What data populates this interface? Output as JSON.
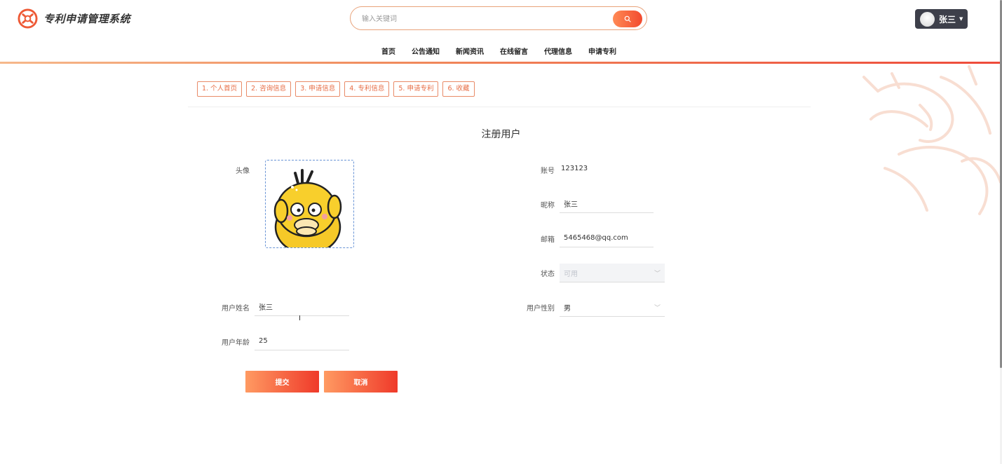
{
  "app": {
    "title": "专利申请管理系统",
    "brand_color": "#ef4a32"
  },
  "search": {
    "placeholder": "输入关键词",
    "value": "",
    "icon": "search-icon"
  },
  "user": {
    "name": "张三",
    "avatar_icon": "avatar",
    "caret_icon": "caret-down-icon"
  },
  "nav": {
    "items": [
      "首页",
      "公告通知",
      "新闻资讯",
      "在线留言",
      "代理信息",
      "申请专利"
    ]
  },
  "tabs": [
    "1. 个人首页",
    "2. 咨询信息",
    "3. 申请信息",
    "4. 专利信息",
    "5. 申请专利",
    "6. 收藏"
  ],
  "form": {
    "title": "注册用户",
    "avatar_label": "头像",
    "account_label": "账号",
    "account_value": "123123",
    "nickname_label": "昵称",
    "nickname_value": "张三",
    "email_label": "邮箱",
    "email_value": "5465468@qq.com",
    "status_label": "状态",
    "status_value": "可用",
    "realname_label": "用户姓名",
    "realname_value": "张三",
    "gender_label": "用户性别",
    "gender_value": "男",
    "age_label": "用户年龄",
    "age_value": "25",
    "submit_label": "提交",
    "cancel_label": "取消"
  }
}
